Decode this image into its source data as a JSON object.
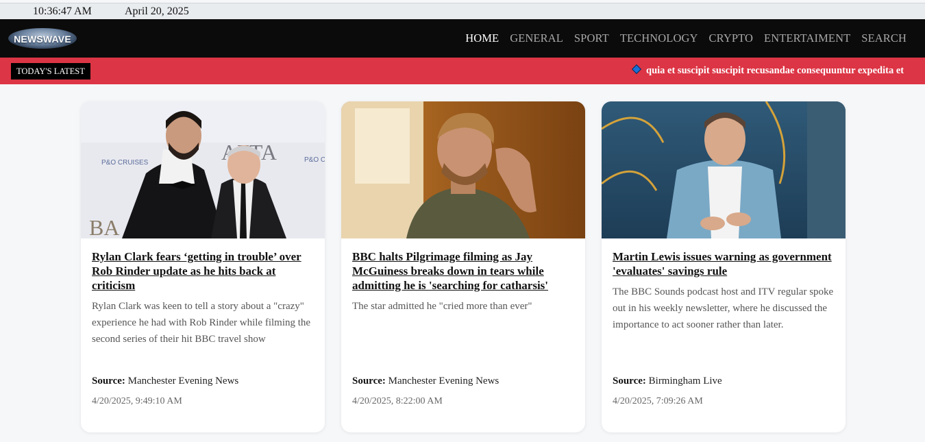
{
  "topbar": {
    "time": "10:36:47 AM",
    "date": "April 20, 2025"
  },
  "brand": {
    "logo_text": "NEWSWAVE"
  },
  "nav": {
    "items": [
      "HOME",
      "GENERAL",
      "SPORT",
      "TECHNOLOGY",
      "CRYPTO",
      "ENTERTAIMENT",
      "SEARCH"
    ],
    "active": "HOME"
  },
  "ticker": {
    "label": "TODAY'S LATEST",
    "headline": "quia et suscipit suscipit recusandae consequuntur expedita et"
  },
  "source_label": "Source:",
  "articles": [
    {
      "title": "Rylan Clark fears ‘getting in trouble’ over Rob Rinder update as he hits back at criticism",
      "description": "Rylan Clark was keen to tell a story about a \"crazy\" experience he had with Rob Rinder while filming the second series of their hit BBC travel show",
      "source": "Manchester Evening News",
      "published": "4/20/2025, 9:49:10 AM"
    },
    {
      "title": "BBC halts Pilgrimage filming as Jay McGuiness breaks down in tears while admitting he is 'searching for catharsis'",
      "description": "The star admitted he \"cried more than ever\"",
      "source": "Manchester Evening News",
      "published": "4/20/2025, 8:22:00 AM"
    },
    {
      "title": "Martin Lewis issues warning as government 'evaluates' savings rule",
      "description": "The BBC Sounds podcast host and ITV regular spoke out in his weekly newsletter, where he discussed the importance to act sooner rather than later.",
      "source": "Birmingham Live",
      "published": "4/20/2025, 7:09:26 AM"
    }
  ],
  "colors": {
    "nav_bg": "#0b0b0b",
    "ticker_bg": "#dc3545",
    "page_bg": "#f6f7f9"
  }
}
